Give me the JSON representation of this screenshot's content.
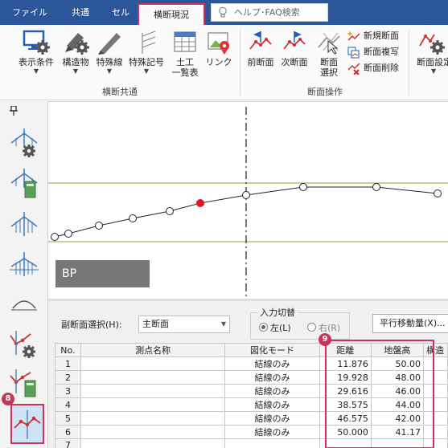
{
  "menu": {
    "tabs": [
      {
        "label": "ファイル"
      },
      {
        "label": "共通"
      },
      {
        "label": "セル"
      },
      {
        "label": "横断現況"
      }
    ],
    "help_placeholder": "ヘルプ･FAQ検索"
  },
  "ribbon": {
    "buttons": [
      {
        "label": "表示条件",
        "icon": "display-settings-icon",
        "dropdown": true
      },
      {
        "label": "構造物",
        "icon": "structure-icon",
        "dropdown": true
      },
      {
        "label": "特殊線",
        "icon": "special-line-icon",
        "dropdown": true
      },
      {
        "label": "特殊記号",
        "icon": "special-symbol-icon",
        "dropdown": true
      },
      {
        "label_line1": "土工",
        "label_line2": "一覧表",
        "icon": "earthwork-table-icon"
      },
      {
        "label": "リンク",
        "icon": "link-icon"
      },
      {
        "label": "前断面",
        "icon": "prev-section-icon"
      },
      {
        "label": "次断面",
        "icon": "next-section-icon"
      },
      {
        "label_line1": "断面",
        "label_line2": "選択",
        "icon": "section-select-icon"
      },
      {
        "label": "断面設定",
        "icon": "section-settings-icon",
        "dropdown": true
      }
    ],
    "small_buttons": [
      {
        "label": "新規断面",
        "icon": "new-section-icon"
      },
      {
        "label": "断面複写",
        "icon": "copy-section-icon"
      },
      {
        "label": "断面削除",
        "icon": "delete-section-icon"
      }
    ],
    "groups": [
      {
        "label": "横断共通"
      },
      {
        "label": "断面操作"
      }
    ]
  },
  "left_panel": {
    "pin_icon": "pin-icon",
    "tools": [
      "section-settings-tool-icon",
      "section-data-tool-icon",
      "ground-line-tool-icon",
      "design-line-tool-icon",
      "arc-tool-icon",
      "point-settings-tool-icon",
      "point-data-tool-icon",
      "point-input-tool-icon"
    ],
    "marker": "8"
  },
  "cross_section": {
    "label": "BP",
    "colors": {
      "guide_line": "#a29a2a",
      "selected_point": "#e8141c",
      "profile": "#222222"
    }
  },
  "lower": {
    "subsection_label": "副断面選択(H):",
    "subsection_value": "主断面",
    "input_switch": {
      "title": "入力切替",
      "left": "左(L)",
      "right": "右(R)",
      "selected": "left"
    },
    "offset_button": "平行移動量(X)...",
    "marker": "9"
  },
  "grid": {
    "columns": [
      "No.",
      "測点名称",
      "図化モード",
      "距離",
      "地盤高",
      "構造"
    ],
    "rows": [
      {
        "no": "1",
        "name": "",
        "mode": "結線のみ",
        "distance": "11.876",
        "elevation": "50.00",
        "struct": ""
      },
      {
        "no": "2",
        "name": "",
        "mode": "結線のみ",
        "distance": "19.928",
        "elevation": "48.00",
        "struct": ""
      },
      {
        "no": "3",
        "name": "",
        "mode": "結線のみ",
        "distance": "29.616",
        "elevation": "46.00",
        "struct": ""
      },
      {
        "no": "4",
        "name": "",
        "mode": "結線のみ",
        "distance": "38.575",
        "elevation": "44.00",
        "struct": ""
      },
      {
        "no": "5",
        "name": "",
        "mode": "結線のみ",
        "distance": "46.575",
        "elevation": "42.00",
        "struct": ""
      },
      {
        "no": "6",
        "name": "",
        "mode": "結線のみ",
        "distance": "50.000",
        "elevation": "41.17",
        "struct": ""
      },
      {
        "no": "7",
        "name": "",
        "mode": "",
        "distance": "",
        "elevation": "",
        "struct": ""
      }
    ]
  }
}
